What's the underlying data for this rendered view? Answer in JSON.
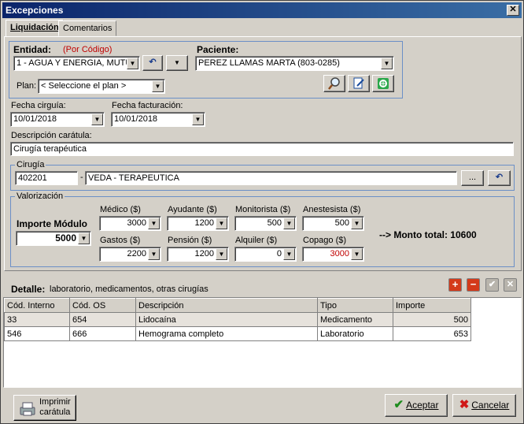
{
  "window": {
    "title": "Excepciones",
    "close": "✕"
  },
  "tabs": [
    {
      "label": "Liquidación"
    },
    {
      "label": "Comentarios"
    }
  ],
  "entidad": {
    "label": "Entidad:",
    "hint": "(Por Código)",
    "value": "1 - AGUA Y ENERGIA, MUTU"
  },
  "paciente": {
    "label": "Paciente:",
    "value": "PEREZ LLAMAS MARTA (803-0285)"
  },
  "plan": {
    "label": "Plan:",
    "value": "< Seleccione el plan >"
  },
  "fecha_cirugia": {
    "label": "Fecha cirguía:",
    "value": "10/01/2018"
  },
  "fecha_facturacion": {
    "label": "Fecha facturación:",
    "value": "10/01/2018"
  },
  "descripcion": {
    "label": "Descripción carátula:",
    "value": "Cirugía terapéutica"
  },
  "cirugia": {
    "legend": "Cirugía",
    "code": "402201",
    "sep": "-",
    "name": "VEDA -  TERAPEUTICA",
    "dots": "..."
  },
  "valorizacion": {
    "legend": "Valorización",
    "importe_label": "Importe Módulo",
    "importe_value": "5000",
    "medico": {
      "label": "Médico ($)",
      "value": "3000"
    },
    "ayudante": {
      "label": "Ayudante ($)",
      "value": "1200"
    },
    "monitorista": {
      "label": "Monitorista ($)",
      "value": "500"
    },
    "anestesista": {
      "label": "Anestesista ($)",
      "value": "500"
    },
    "gastos": {
      "label": "Gastos ($)",
      "value": "2200"
    },
    "pension": {
      "label": "Pensión ($)",
      "value": "1200"
    },
    "alquiler": {
      "label": "Alquiler ($)",
      "value": "0"
    },
    "copago": {
      "label": "Copago ($)",
      "value": "3000"
    },
    "total": "--> Monto total: 10600"
  },
  "detalle": {
    "label": "Detalle:",
    "subtitle": "laboratorio, medicamentos, otras cirugías",
    "columns": [
      "Cód. Interno",
      "Cód. OS",
      "Descripción",
      "Tipo",
      "Importe"
    ],
    "rows": [
      [
        "33",
        "654",
        "Lidocaína",
        "Medicamento",
        "500"
      ],
      [
        "546",
        "666",
        "Hemograma completo",
        "Laboratorio",
        "653"
      ]
    ]
  },
  "buttons": {
    "imprimir_line1": "Imprimir",
    "imprimir_line2": "carátula",
    "aceptar": "Aceptar",
    "cancelar": "Cancelar"
  },
  "colors": {
    "title_start": "#0a246a",
    "title_end": "#3a6ea5",
    "copago_red": "#c00000"
  }
}
